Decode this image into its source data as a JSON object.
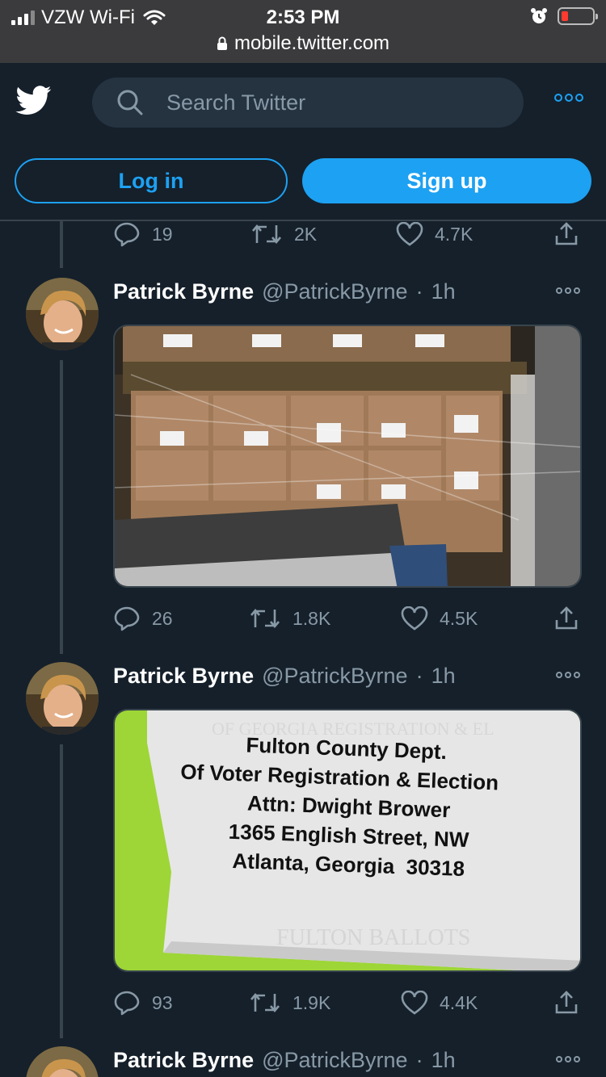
{
  "status_bar": {
    "carrier": "VZW Wi-Fi",
    "time": "2:53 PM",
    "url": "mobile.twitter.com"
  },
  "header": {
    "search_placeholder": "Search Twitter",
    "login_label": "Log in",
    "signup_label": "Sign up"
  },
  "colors": {
    "background": "#15202b",
    "accent": "#1da1f2",
    "muted": "#8899a6"
  },
  "previous_tweet_actions": {
    "replies": "19",
    "retweets": "2K",
    "likes": "4.7K"
  },
  "tweets": [
    {
      "name": "Patrick Byrne",
      "handle": "@PatrickByrne",
      "separator": "·",
      "time": "1h",
      "replies": "26",
      "retweets": "1.8K",
      "likes": "4.5K"
    },
    {
      "name": "Patrick Byrne",
      "handle": "@PatrickByrne",
      "separator": "·",
      "time": "1h",
      "label_lines": [
        "Fulton County Dept.",
        "Of Voter Registration & Election",
        "Attn: Dwight Brower",
        "1365 English Street, NW",
        "Atlanta, Georgia  30318"
      ],
      "replies": "93",
      "retweets": "1.9K",
      "likes": "4.4K"
    },
    {
      "name": "Patrick Byrne",
      "handle": "@PatrickByrne",
      "separator": "·",
      "time": "1h"
    }
  ]
}
